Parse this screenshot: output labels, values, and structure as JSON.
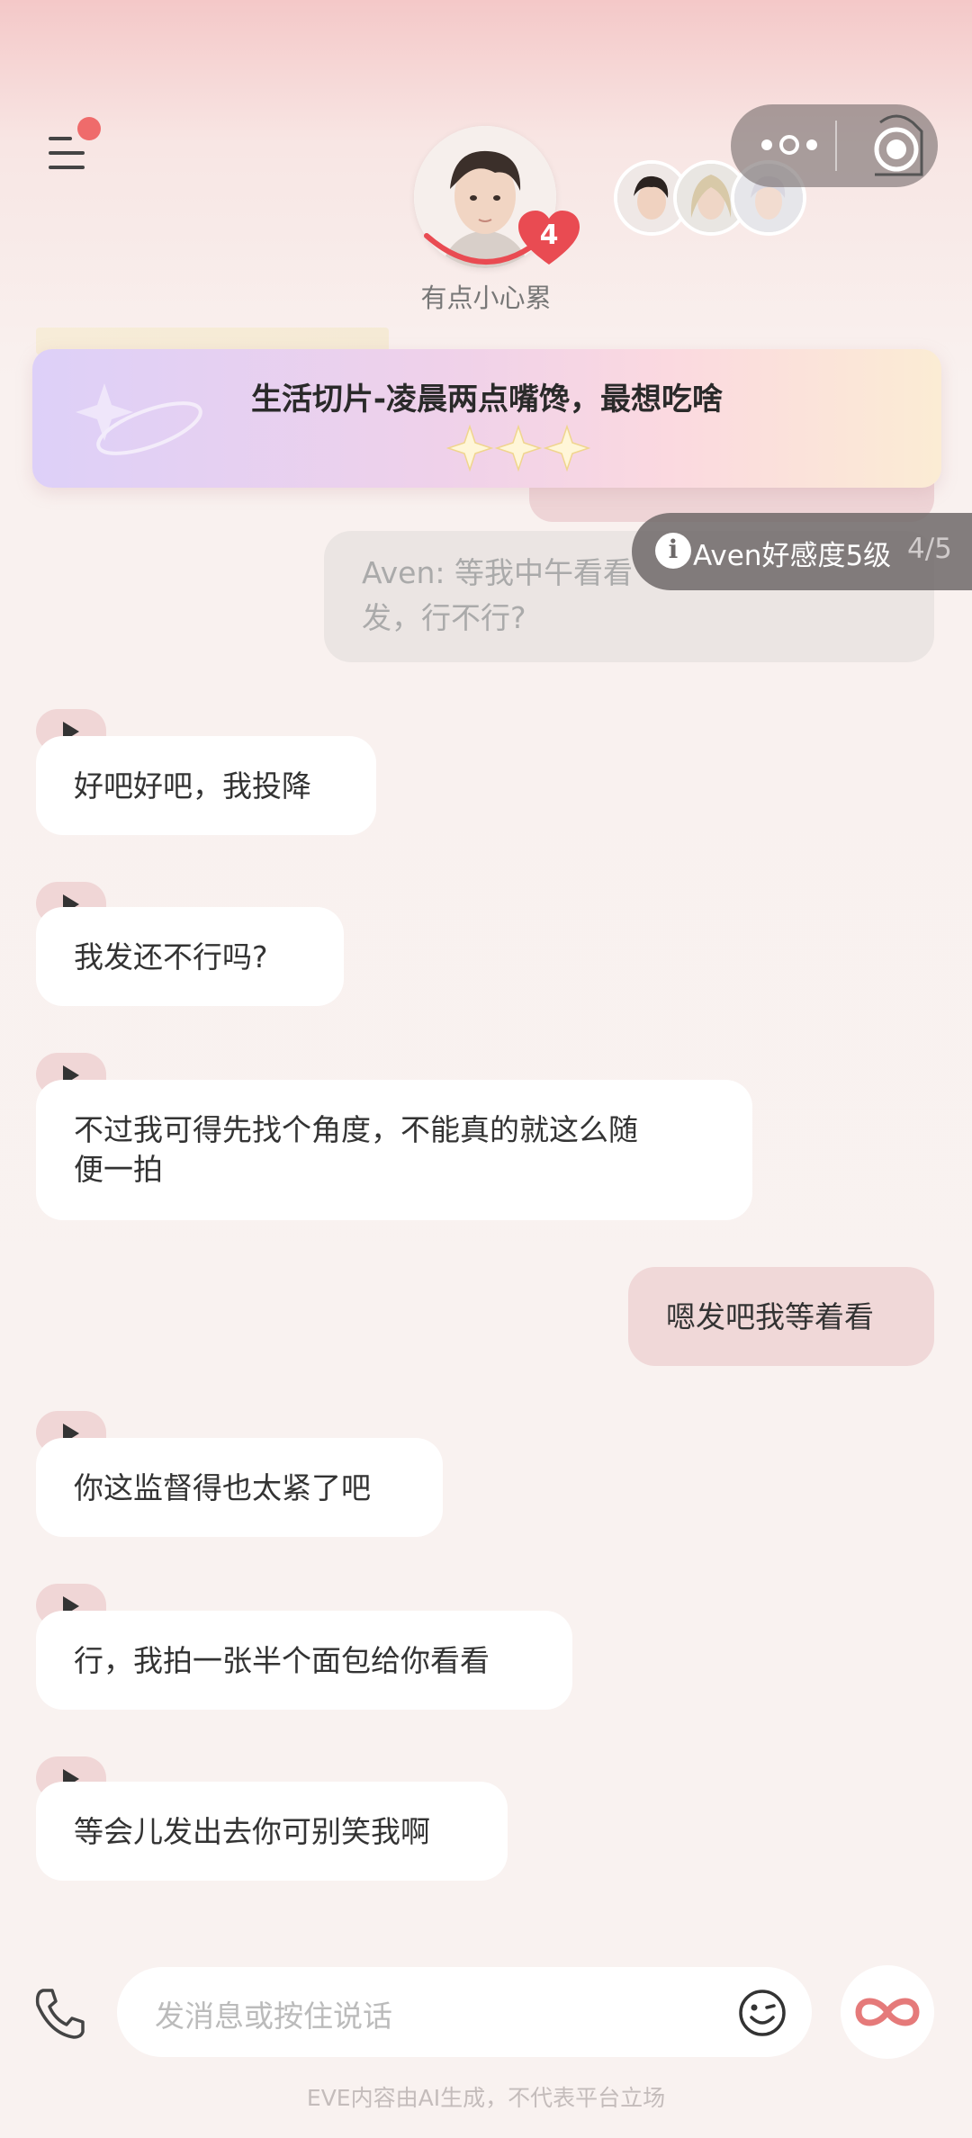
{
  "header": {
    "mood_text": "有点小心累",
    "badge_count": "4",
    "colors": {
      "accent": "#e94b52",
      "menu_dot": "#ef6b6b"
    }
  },
  "banner": {
    "title": "生活切片-凌晨两点嘴馋，最想吃啥",
    "stars": "✦✦✦"
  },
  "affinity_toast": {
    "icon": "i",
    "label": "Aven好感度5级",
    "count": "4/5"
  },
  "quoted_message": {
    "line1": "Aven: 等我中午看看",
    "line2": "发，行不行?"
  },
  "messages": [
    {
      "from": "ai",
      "text": "好吧好吧，我投降"
    },
    {
      "from": "ai",
      "text": "我发还不行吗?"
    },
    {
      "from": "ai",
      "text_line1": "不过我可得先找个角度，不能真的就这么随",
      "text_line2": "便一拍"
    },
    {
      "from": "me",
      "text": "嗯发吧我等着看"
    },
    {
      "from": "ai",
      "text": "你这监督得也太紧了吧"
    },
    {
      "from": "ai",
      "text": "行，我拍一张半个面包给你看看"
    },
    {
      "from": "ai",
      "text": "等会儿发出去你可别笑我啊"
    }
  ],
  "input_bar": {
    "placeholder": "发消息或按住说话"
  },
  "footer": {
    "disclaimer": "EVE内容由AI生成，不代表平台立场"
  },
  "icons": [
    "menu-icon",
    "more-dots-icon",
    "record-icon",
    "heart-icon",
    "play-icon",
    "phone-icon",
    "emoji-icon",
    "infinity-icon",
    "info-icon",
    "sparkle-icon"
  ]
}
